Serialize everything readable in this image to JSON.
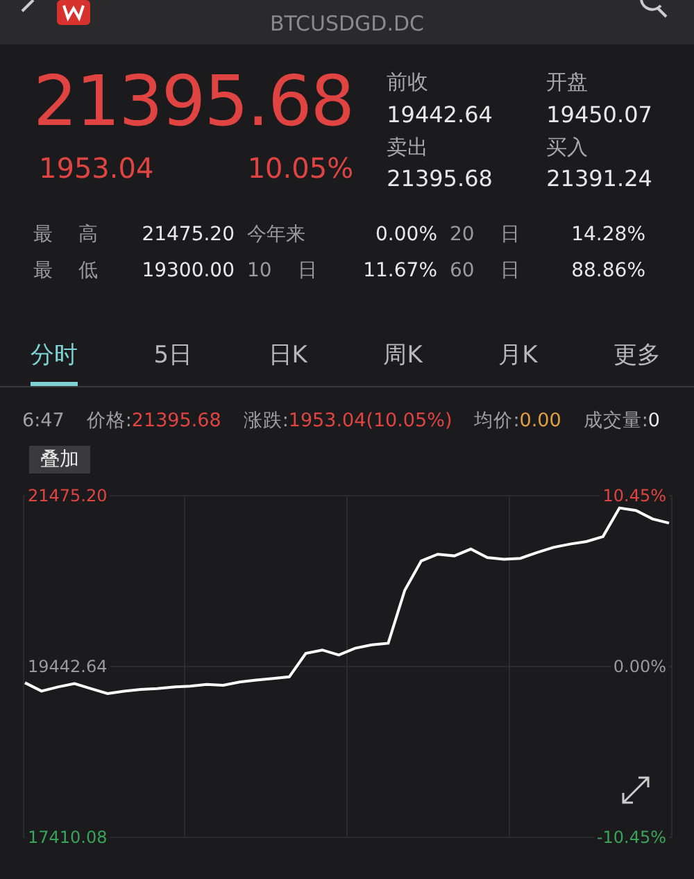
{
  "header": {
    "symbol": "BTCUSDGD.DC"
  },
  "quote": {
    "price": "21395.68",
    "change": "1953.04",
    "change_pct": "10.05%"
  },
  "quote_fields": [
    {
      "label": "前收",
      "value": "19442.64"
    },
    {
      "label": "开盘",
      "value": "19450.07"
    },
    {
      "label": "卖出",
      "value": "21395.68"
    },
    {
      "label": "买入",
      "value": "21391.24"
    }
  ],
  "stats": [
    [
      {
        "label": "最 高",
        "value": "21475.20"
      },
      {
        "label": "今年来",
        "value": "0.00%"
      },
      {
        "label": "20 日",
        "value": "14.28%"
      }
    ],
    [
      {
        "label": "最 低",
        "value": "19300.00"
      },
      {
        "label": "10 日",
        "value": "11.67%"
      },
      {
        "label": "60 日",
        "value": "88.86%"
      }
    ]
  ],
  "tabs": [
    {
      "label": "分时",
      "selected": true
    },
    {
      "label": "5日",
      "selected": false
    },
    {
      "label": "日K",
      "selected": false
    },
    {
      "label": "周K",
      "selected": false
    },
    {
      "label": "月K",
      "selected": false
    },
    {
      "label": "更多",
      "selected": false
    }
  ],
  "info_bar": {
    "time": "6:47",
    "items": [
      {
        "label": "价格:",
        "value": "21395.68",
        "color": "#e04442"
      },
      {
        "label": "涨跌:",
        "value": "1953.04(10.05%)",
        "color": "#e04442"
      },
      {
        "label": "均价:",
        "value": "0.00",
        "color": "#e0a040"
      },
      {
        "label": "成交量:",
        "value": "0",
        "color": "#e8e8e8"
      }
    ]
  },
  "overlay_button": "叠加",
  "chart": {
    "right_labels": [
      "10.45%",
      "0.00%",
      "-10.45%"
    ],
    "chart_data": {
      "type": "line",
      "ylim": [
        17410.08,
        21475.2
      ],
      "yticks": [
        {
          "value": 21475.2,
          "label": "21475.20"
        },
        {
          "value": 19442.64,
          "label": "19442.64"
        },
        {
          "value": 17410.08,
          "label": "17410.08"
        }
      ],
      "series": [
        {
          "color": "#ffffff",
          "values": [
            19250,
            19150,
            19200,
            19240,
            19180,
            19120,
            19150,
            19170,
            19180,
            19200,
            19210,
            19230,
            19220,
            19260,
            19280,
            19300,
            19320,
            19600,
            19640,
            19580,
            19660,
            19700,
            19720,
            20350,
            20700,
            20780,
            20760,
            20840,
            20740,
            20720,
            20730,
            20800,
            20860,
            20900,
            20930,
            20990,
            21330,
            21300,
            21200,
            21150
          ]
        }
      ]
    }
  }
}
